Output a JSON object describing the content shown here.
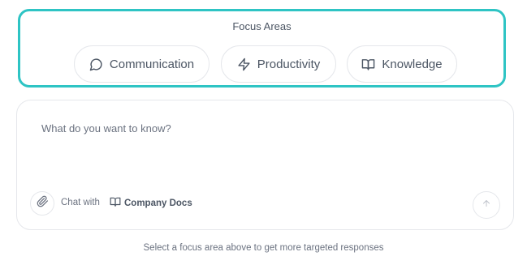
{
  "focus": {
    "title": "Focus Areas",
    "chips": [
      {
        "label": "Communication",
        "icon": "message-circle-icon"
      },
      {
        "label": "Productivity",
        "icon": "zap-icon"
      },
      {
        "label": "Knowledge",
        "icon": "book-open-icon"
      }
    ],
    "accent_color": "#2ec4c4"
  },
  "chat": {
    "placeholder": "What do you want to know?",
    "value": "",
    "attach_icon": "paperclip-icon",
    "chat_with_label": "Chat with",
    "source_label": "Company Docs",
    "source_icon": "book-open-icon",
    "send_icon": "arrow-up-icon"
  },
  "hint": "Select a focus area above to get more targeted responses"
}
